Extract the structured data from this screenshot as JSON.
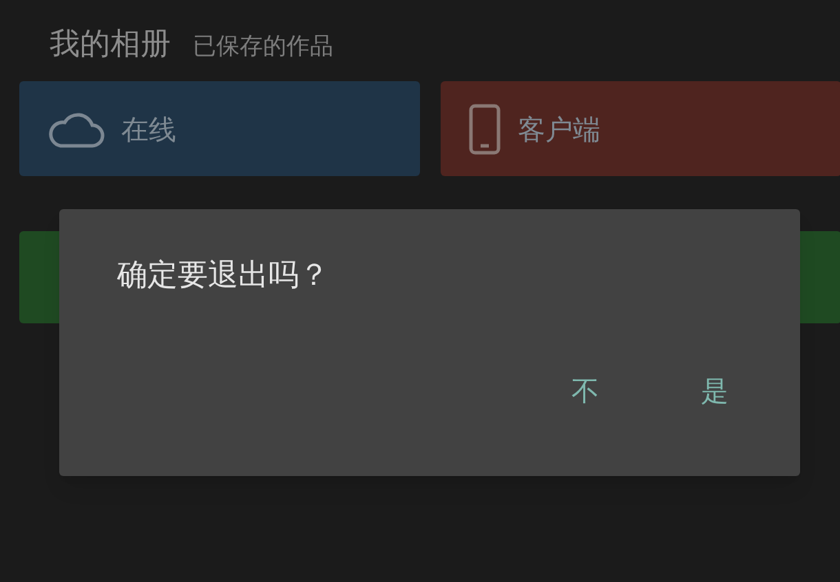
{
  "header": {
    "title": "我的相册",
    "subtitle": "已保存的作品"
  },
  "tiles": [
    {
      "label": "在线",
      "color": "#1f3447"
    },
    {
      "label": "客户端",
      "color": "#4f241f"
    }
  ],
  "hidden_tiles": [
    {
      "color": "#1f4a22"
    },
    {
      "color": "#1f4a22"
    }
  ],
  "dialog": {
    "message": "确定要退出吗？",
    "buttons": [
      "不",
      "是"
    ]
  }
}
